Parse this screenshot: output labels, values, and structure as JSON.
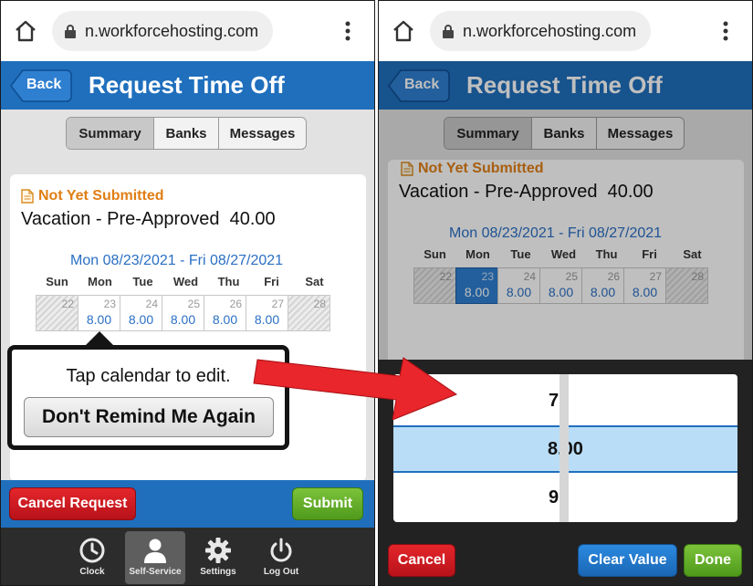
{
  "browser": {
    "url": "n.workforcehosting.com"
  },
  "header": {
    "back_label": "Back",
    "title": "Request Time Off"
  },
  "tabs": [
    {
      "label": "Summary",
      "active": true
    },
    {
      "label": "Banks",
      "active": false
    },
    {
      "label": "Messages",
      "active": false
    }
  ],
  "request": {
    "status": "Not Yet Submitted",
    "type_line": "Vacation - Pre-Approved  40.00",
    "date_range": "Mon 08/23/2021 - Fri 08/27/2021"
  },
  "calendar": {
    "weekdays": [
      "Sun",
      "Mon",
      "Tue",
      "Wed",
      "Thu",
      "Fri",
      "Sat"
    ],
    "days": [
      {
        "day": "22",
        "hours": ""
      },
      {
        "day": "23",
        "hours": "8.00"
      },
      {
        "day": "24",
        "hours": "8.00"
      },
      {
        "day": "25",
        "hours": "8.00"
      },
      {
        "day": "26",
        "hours": "8.00"
      },
      {
        "day": "27",
        "hours": "8.00"
      },
      {
        "day": "28",
        "hours": ""
      }
    ]
  },
  "tooltip": {
    "text": "Tap calendar to edit.",
    "button_label": "Don't Remind Me Again"
  },
  "actions": {
    "cancel_request": "Cancel Request",
    "submit": "Submit"
  },
  "bottom_nav": [
    {
      "label": "Clock",
      "icon": "clock-icon"
    },
    {
      "label": "Self-Service",
      "icon": "person-icon",
      "active": true
    },
    {
      "label": "Settings",
      "icon": "gear-icon"
    },
    {
      "label": "Log Out",
      "icon": "power-icon"
    }
  ],
  "picker": {
    "values": [
      "7",
      "8.00",
      "9"
    ],
    "selected": "8.00"
  },
  "picker_actions": {
    "cancel": "Cancel",
    "clear_value": "Clear Value",
    "done": "Done"
  },
  "colors": {
    "header_blue": "#1f6fbd",
    "status_orange": "#e07e14",
    "date_blue": "#2a6fc4",
    "danger_red": "#d01c22",
    "success_green": "#5fa823",
    "arrow_red": "#e8262b"
  }
}
